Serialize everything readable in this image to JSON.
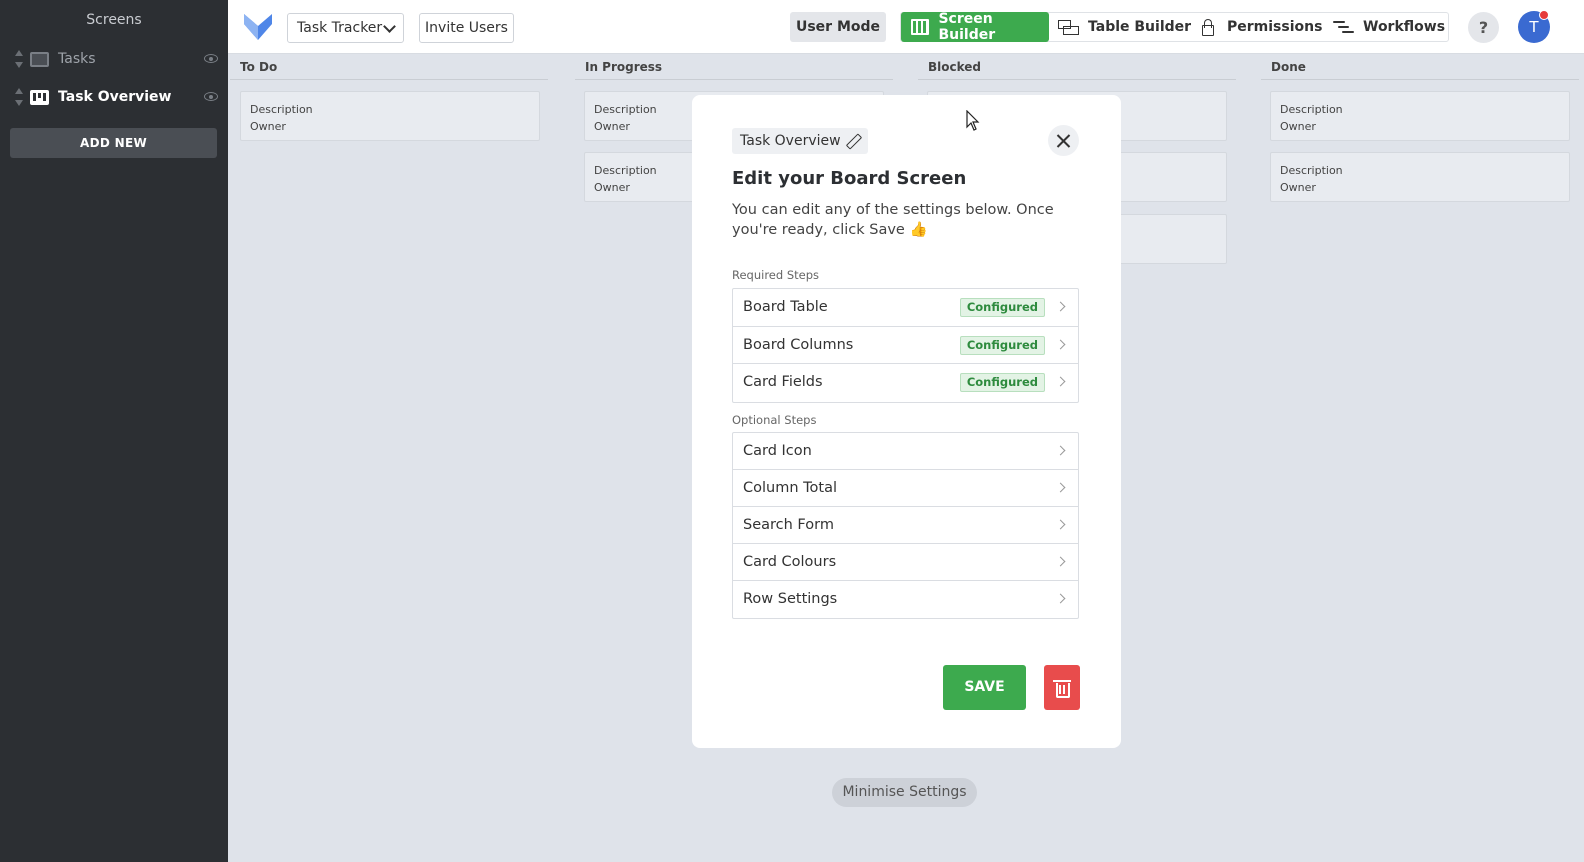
{
  "sidebar": {
    "title": "Screens",
    "items": [
      {
        "label": "Tasks",
        "icon": "table-icon"
      },
      {
        "label": "Task Overview",
        "icon": "board-icon"
      }
    ],
    "add_new": "ADD NEW"
  },
  "topbar": {
    "app_name": "Task Tracker",
    "invite": "Invite Users",
    "user_mode": "User Mode",
    "nav": {
      "screen_builder": "Screen Builder",
      "table_builder": "Table Builder",
      "permissions": "Permissions",
      "workflows": "Workflows"
    },
    "help": "?",
    "avatar_initial": "T"
  },
  "board": {
    "columns": [
      {
        "title": "To Do"
      },
      {
        "title": "In Progress"
      },
      {
        "title": "Blocked"
      },
      {
        "title": "Done"
      }
    ],
    "card_fields": {
      "line1": "Description",
      "line2": "Owner"
    }
  },
  "modal": {
    "screen_name": "Task Overview",
    "title": "Edit your Board Screen",
    "description": "You can edit any of the settings below. Once you're ready, click Save 👍",
    "required_label": "Required Steps",
    "required_steps": [
      {
        "label": "Board Table",
        "status": "Configured"
      },
      {
        "label": "Board Columns",
        "status": "Configured"
      },
      {
        "label": "Card Fields",
        "status": "Configured"
      }
    ],
    "optional_label": "Optional Steps",
    "optional_steps": [
      {
        "label": "Card Icon"
      },
      {
        "label": "Column Total"
      },
      {
        "label": "Search Form"
      },
      {
        "label": "Card Colours"
      },
      {
        "label": "Row Settings"
      }
    ],
    "save": "SAVE"
  },
  "minimise": "Minimise Settings",
  "colors": {
    "sidebar_bg": "#2c2f33",
    "accent_green": "#3daa4e",
    "danger_red": "#e84c4c",
    "avatar_blue": "#3a6ad1"
  }
}
